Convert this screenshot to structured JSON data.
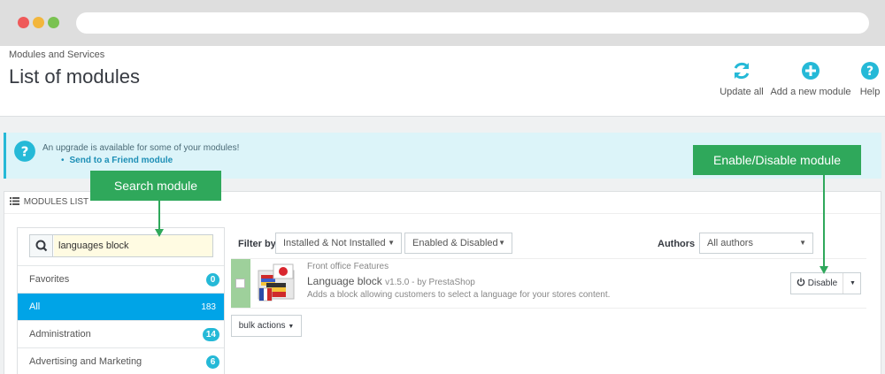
{
  "page": {
    "breadcrumb": "Modules and Services",
    "title": "List of modules"
  },
  "toolbar": {
    "update_label": "Update all",
    "add_label": "Add a new module",
    "help_label": "Help"
  },
  "alert": {
    "message": "An upgrade is available for some of your modules!",
    "items": [
      "Send to a Friend module"
    ]
  },
  "panel": {
    "heading": "MODULES LIST"
  },
  "search": {
    "value": "languages block",
    "placeholder": ""
  },
  "categories": [
    {
      "label": "Favorites",
      "count": "0",
      "active": false
    },
    {
      "label": "All",
      "count": "183",
      "active": true
    },
    {
      "label": "Administration",
      "count": "14",
      "active": false
    },
    {
      "label": "Advertising and Marketing",
      "count": "6",
      "active": false
    }
  ],
  "filters": {
    "filter_by_label": "Filter by",
    "install_selected": "Installed & Not Installed",
    "status_selected": "Enabled & Disabled",
    "authors_label": "Authors",
    "authors_selected": "All authors"
  },
  "module": {
    "category": "Front office Features",
    "name": "Language block",
    "version": "v1.5.0 - by PrestaShop",
    "description": "Adds a block allowing customers to select a language for your stores content.",
    "action_label": "Disable"
  },
  "bulk": {
    "label": "bulk actions"
  },
  "callouts": {
    "search": "Search module",
    "enable": "Enable/Disable module"
  },
  "colors": {
    "accent": "#25b9d7",
    "active": "#00a4e7",
    "callout": "#2fa85b",
    "alert_bg": "#dcf4f9"
  }
}
